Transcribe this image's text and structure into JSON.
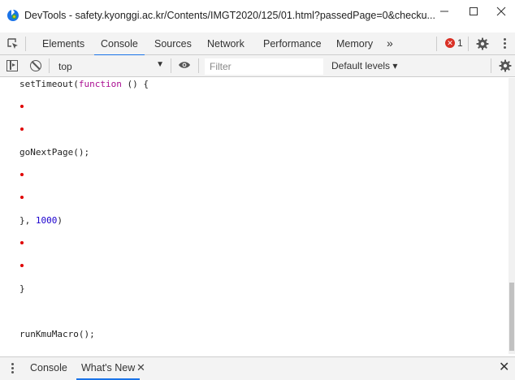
{
  "window": {
    "title": "DevTools - safety.kyonggi.ac.kr/Contents/IMGT2020/125/01.html?passedPage=0&checku...",
    "minimize_glyph": "—",
    "maximize_glyph": "☐",
    "close_glyph": "✕"
  },
  "main_tabs": [
    {
      "label": "Elements"
    },
    {
      "label": "Console"
    },
    {
      "label": "Sources"
    },
    {
      "label": "Network"
    },
    {
      "label": "Performance"
    },
    {
      "label": "Memory"
    }
  ],
  "more_tabs_glyph": "»",
  "errors": {
    "icon": "✕",
    "count": "1"
  },
  "console_toolbar": {
    "context": "top",
    "filter_placeholder": "Filter",
    "levels": "Default levels ▾"
  },
  "console_lines": {
    "l1_a": "setTimeout(",
    "l1_kw": "function",
    "l1_b": " () {",
    "l2": "goNextPage();",
    "l3_a": "}, ",
    "l3_num": "1000",
    "l3_b": ")",
    "l4": "}",
    "l5": "runKmuMacro();"
  },
  "drawer": {
    "tabs": [
      {
        "label": "Console"
      },
      {
        "label": "What's New"
      }
    ],
    "tab_close_glyph": "✕",
    "close_glyph": "✕"
  },
  "colors": {
    "accent": "#1a73e8",
    "error": "#d93025",
    "bullet": "#e00000"
  }
}
